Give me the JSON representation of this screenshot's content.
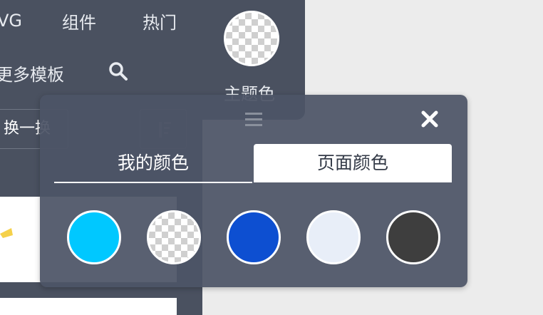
{
  "nav": {
    "svg_label": "VG",
    "components_label": "组件",
    "popular_label": "热门",
    "more_templates_label": "更多模板"
  },
  "theme": {
    "label": "主题色"
  },
  "toolbar": {
    "shuffle_label": "换一换"
  },
  "popup": {
    "tabs": [
      {
        "label": "我的颜色",
        "active": false
      },
      {
        "label": "页面颜色",
        "active": true
      }
    ],
    "swatches": [
      {
        "color": "#00c8ff",
        "type": "solid"
      },
      {
        "color": "transparent",
        "type": "transparent"
      },
      {
        "color": "#0d4fd1",
        "type": "solid"
      },
      {
        "color": "#e8eef8",
        "type": "solid"
      },
      {
        "color": "#3e3e3e",
        "type": "solid"
      }
    ]
  },
  "icons": {
    "search": "search-icon",
    "close": "close-icon",
    "drag": "drag-handle-icon",
    "sort": "sort-icon"
  },
  "colors": {
    "panel_bg": "#4a5160",
    "popup_bg": "#4c5466",
    "page_bg": "#ececec"
  }
}
